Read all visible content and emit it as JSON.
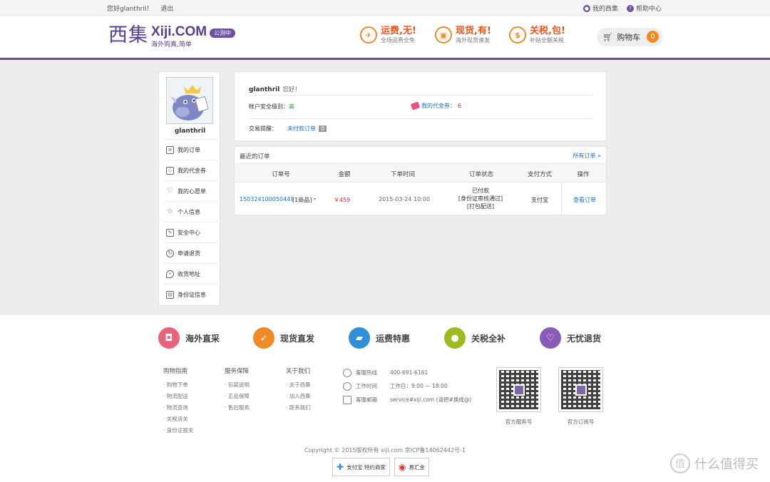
{
  "topbar": {
    "greeting": "您好glanthril！",
    "logout": "退出",
    "my_xiji": "我的西集",
    "help": "帮助中心"
  },
  "header": {
    "logo_cn": "西集",
    "logo_en": "Xiji.COM",
    "slogan": "海外购真,简单",
    "beta_badge": "公测中",
    "features": [
      {
        "title": "运费,无!",
        "sub": "全场运费全免",
        "icon": "plane-icon"
      },
      {
        "title": "现货,有!",
        "sub": "海外现货速发",
        "icon": "box-icon"
      },
      {
        "title": "关税,包!",
        "sub": "补贴全额关税",
        "icon": "money-icon"
      }
    ],
    "cart_label": "购物车",
    "cart_count": "0"
  },
  "sidebar": {
    "username": "glanthril",
    "items": [
      {
        "label": "我的订单",
        "icon": "order-icon"
      },
      {
        "label": "我的代金券",
        "icon": "coupon-icon"
      },
      {
        "label": "我的心愿单",
        "icon": "heart-icon"
      },
      {
        "label": "个人信息",
        "icon": "star-icon"
      },
      {
        "label": "安全中心",
        "icon": "edit-icon"
      },
      {
        "label": "申请退货",
        "icon": "refresh-icon"
      },
      {
        "label": "收货地址",
        "icon": "location-icon"
      },
      {
        "label": "身份证信息",
        "icon": "id-icon"
      }
    ]
  },
  "account": {
    "username": "glanthril",
    "hello": "您好！",
    "security_label": "帐户安全级别：",
    "security_value": "高",
    "voucher_label": "我的代金券：",
    "voucher_count": "6",
    "reminder_label": "交易提醒：",
    "unpaid_label": "未付款订单",
    "unpaid_count": "0"
  },
  "orders": {
    "title": "最近的订单",
    "all_link": "所有订单 »",
    "columns": [
      "订单号",
      "金额",
      "下单时间",
      "订单状态",
      "支付方式",
      "操作"
    ],
    "rows": [
      {
        "order_id": "150324100050449",
        "items": "[1商品]",
        "amount": "￥459",
        "time": "2015-03-24 10:00",
        "status_1": "已付款",
        "status_2": "[身份证审核通过]",
        "status_3": "[打包配送]",
        "payment": "支付宝",
        "action": "查看订单"
      }
    ]
  },
  "footer": {
    "features": [
      {
        "label": "海外直采",
        "color": "#e8637a",
        "icon": "bag-icon"
      },
      {
        "label": "现货直发",
        "color": "#f08a24",
        "icon": "rocket-icon"
      },
      {
        "label": "运费特惠",
        "color": "#2f8fd8",
        "icon": "truck-icon"
      },
      {
        "label": "关税全补",
        "color": "#9bbb1e",
        "icon": "piggy-icon"
      },
      {
        "label": "无忧退货",
        "color": "#8a5ab8",
        "icon": "return-icon"
      }
    ],
    "columns": [
      {
        "title": "购物指南",
        "items": [
          "购物下单",
          "物流配送",
          "物流查询",
          "关税清关",
          "身份证报关"
        ]
      },
      {
        "title": "服务保障",
        "items": [
          "包装说明",
          "正品保障",
          "售后服务"
        ]
      },
      {
        "title": "关于我们",
        "items": [
          "关于西集",
          "加入西集",
          "联系我们"
        ]
      }
    ],
    "contact": [
      {
        "label": "客服热线",
        "value": "400-691-6161",
        "icon": "phone-icon"
      },
      {
        "label": "工作时间",
        "value": "工作日：9:00 — 18:00",
        "icon": "clock-icon"
      },
      {
        "label": "客服邮箱",
        "value": "service#xiji.com (请把#换成@)",
        "icon": "mail-icon"
      }
    ],
    "qr_labels": [
      "官方服务号",
      "官方订阅号"
    ],
    "copyright": "Copyright © 2015版权所有 xiji.com 京ICP备14062442号-1",
    "badges": [
      "支付宝 特约商家",
      "易汇金"
    ]
  },
  "watermark": {
    "text": "什么值得买",
    "glyph": "值"
  }
}
